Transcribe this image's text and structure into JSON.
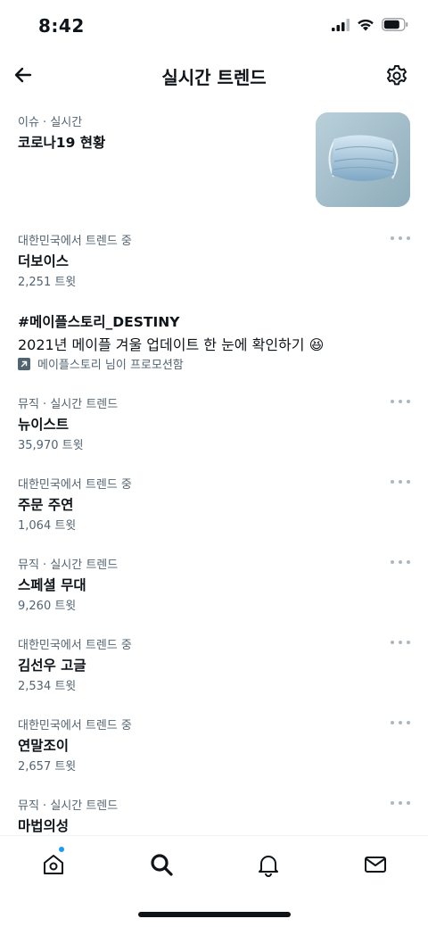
{
  "status_bar": {
    "time": "8:42"
  },
  "header": {
    "title": "실시간 트렌드"
  },
  "featured": {
    "context": "이슈 · 실시간",
    "title": "코로나19 현황",
    "thumbnail": "face-mask-image"
  },
  "promoted": {
    "hashtag": "#메이플스토리_DESTINY",
    "description": "2021년 메이플 겨울 업데이트 한 눈에 확인하기",
    "emoji": "😆",
    "promoted_by": "메이플스토리 님이 프로모션함"
  },
  "trends": [
    {
      "context": "대한민국에서 트렌드 중",
      "name": "더보이스",
      "count": "2,251 트윗"
    },
    {
      "context": "뮤직 · 실시간 트렌드",
      "name": "뉴이스트",
      "count": "35,970 트윗"
    },
    {
      "context": "대한민국에서 트렌드 중",
      "name": "주문 주연",
      "count": "1,064 트윗"
    },
    {
      "context": "뮤직 · 실시간 트렌드",
      "name": "스페셜 무대",
      "count": "9,260 트윗"
    },
    {
      "context": "대한민국에서 트렌드 중",
      "name": "김선우 고글",
      "count": "2,534 트윗"
    },
    {
      "context": "대한민국에서 트렌드 중",
      "name": "연말조이",
      "count": "2,657 트윗"
    },
    {
      "context": "뮤직 · 실시간 트렌드",
      "name": "마법의성",
      "count": ""
    }
  ],
  "tabbar": {
    "tabs": [
      "home-icon",
      "search-icon",
      "bell-icon",
      "mail-icon"
    ],
    "active": "search-icon"
  },
  "colors": {
    "text_primary": "#0f1419",
    "text_secondary": "#536471",
    "accent": "#1d9bf0"
  }
}
